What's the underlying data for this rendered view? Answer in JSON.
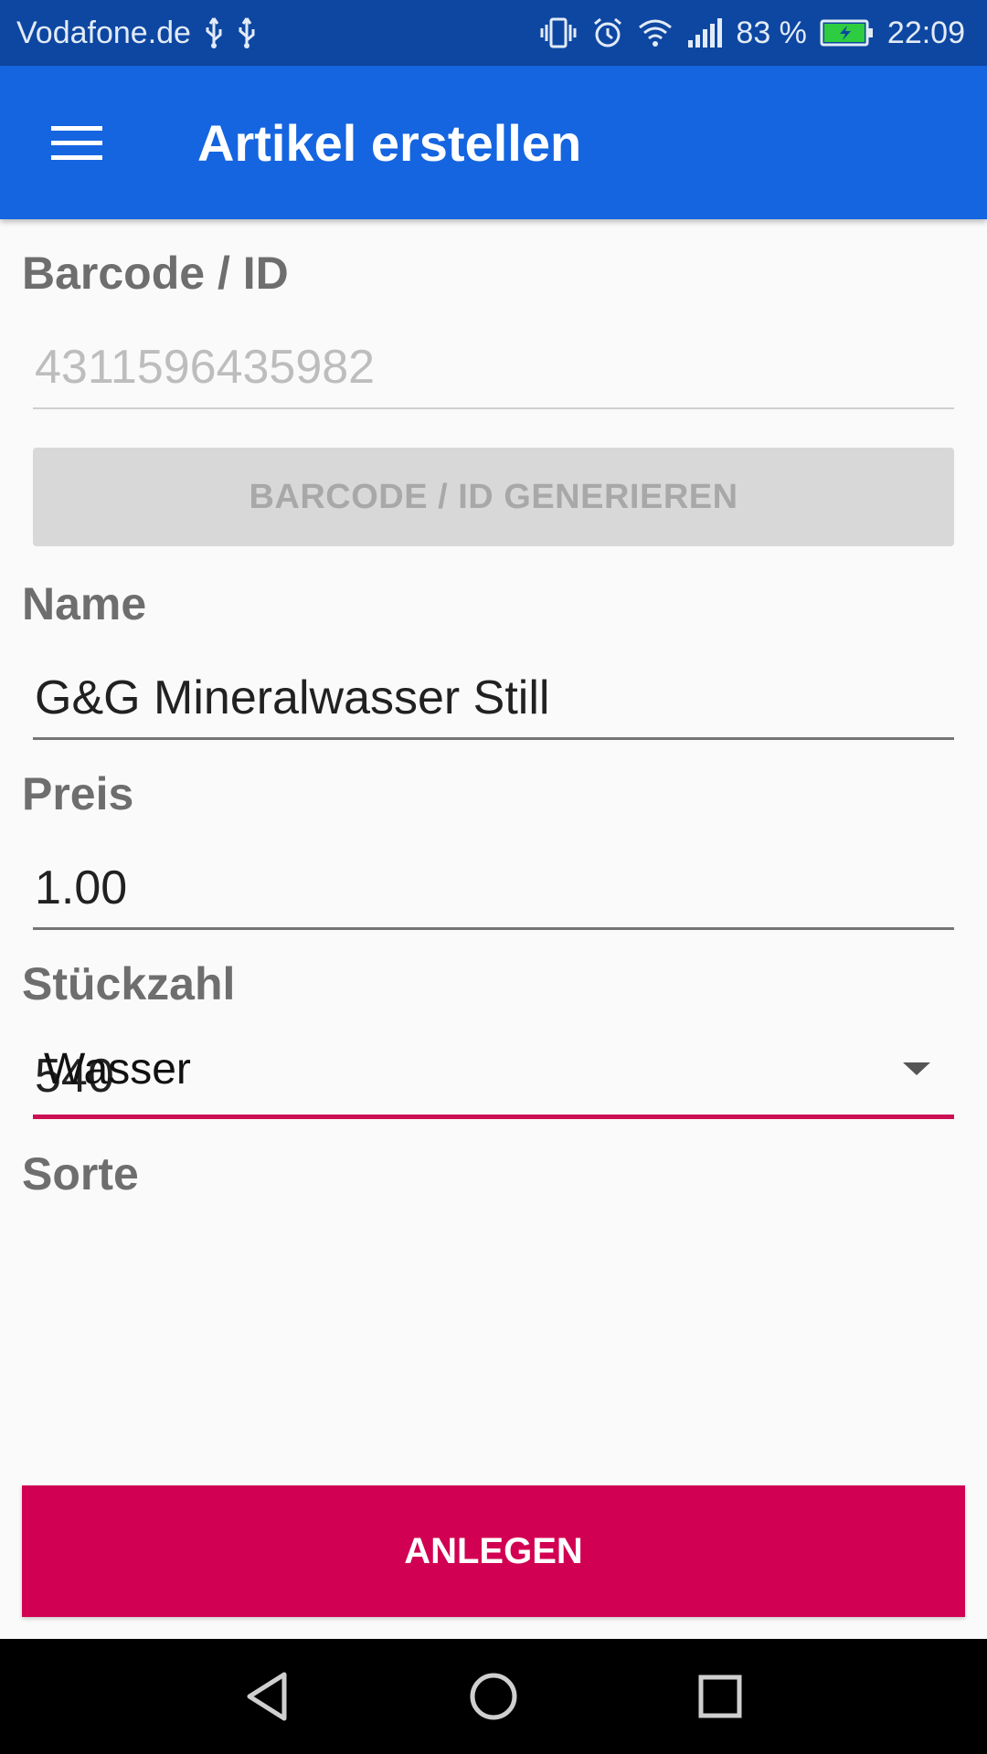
{
  "status_bar": {
    "carrier": "Vodafone.de",
    "battery_percent": "83 %",
    "time": "22:09",
    "icons": [
      "usb-icon",
      "usb-icon",
      "vibrate-icon",
      "alarm-icon",
      "wifi-icon",
      "signal-icon",
      "battery-charging-icon"
    ]
  },
  "app_bar": {
    "title": "Artikel erstellen",
    "menu_icon": "hamburger-menu-icon"
  },
  "form": {
    "barcode": {
      "label": "Barcode / ID",
      "value": "4311596435982"
    },
    "generate_button": "BARCODE / ID GENERIEREN",
    "name": {
      "label": "Name",
      "value": "G&G Mineralwasser Still"
    },
    "price": {
      "label": "Preis",
      "value": "1.00"
    },
    "quantity": {
      "label": "Stückzahl",
      "value": "540"
    },
    "type": {
      "label": "Sorte",
      "selected": "Wasser"
    },
    "submit_button": "ANLEGEN"
  },
  "colors": {
    "status_bar": "#0d47a1",
    "app_bar": "#1565e0",
    "accent": "#d10052",
    "background": "#fafafa"
  },
  "nav_bar": {
    "icons": [
      "back-icon",
      "home-icon",
      "recents-icon"
    ]
  }
}
